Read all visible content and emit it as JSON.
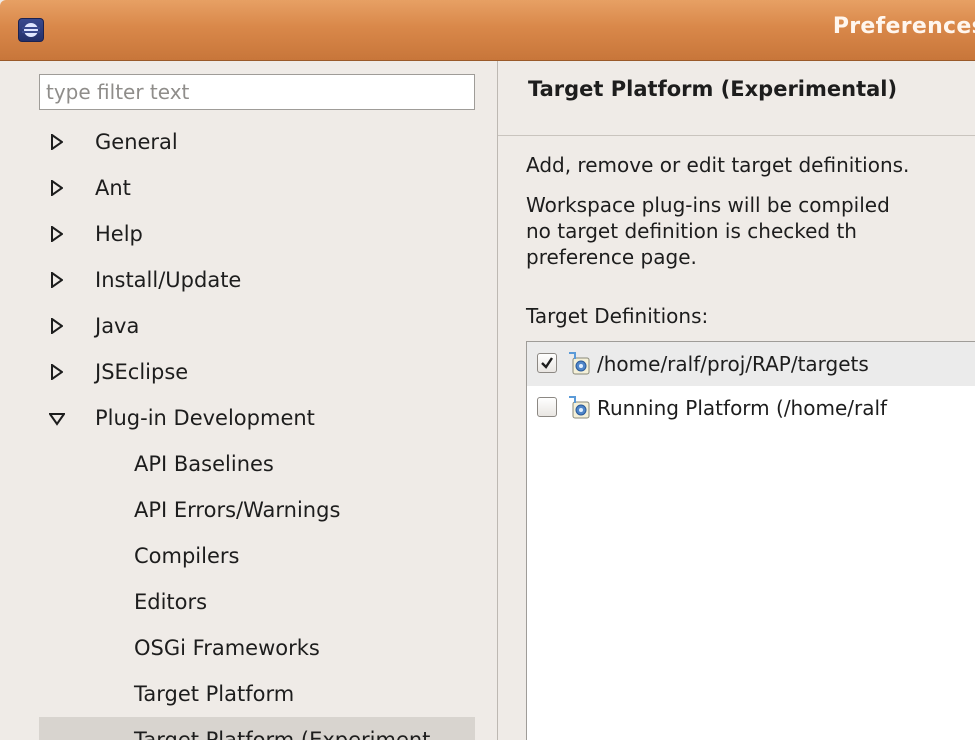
{
  "window": {
    "title": "Preferences"
  },
  "filter": {
    "placeholder": "type filter text",
    "value": ""
  },
  "tree": {
    "items": [
      {
        "label": "General",
        "expanded": false,
        "icon": "triangle-right-icon"
      },
      {
        "label": "Ant",
        "expanded": false,
        "icon": "triangle-right-icon"
      },
      {
        "label": "Help",
        "expanded": false,
        "icon": "triangle-right-icon"
      },
      {
        "label": "Install/Update",
        "expanded": false,
        "icon": "triangle-right-icon"
      },
      {
        "label": "Java",
        "expanded": false,
        "icon": "triangle-right-icon"
      },
      {
        "label": "JSEclipse",
        "expanded": false,
        "icon": "triangle-right-icon"
      },
      {
        "label": "Plug-in Development",
        "expanded": true,
        "icon": "triangle-down-icon"
      }
    ],
    "children": [
      {
        "label": "API Baselines"
      },
      {
        "label": "API Errors/Warnings"
      },
      {
        "label": "Compilers"
      },
      {
        "label": "Editors"
      },
      {
        "label": "OSGi Frameworks"
      },
      {
        "label": "Target Platform"
      },
      {
        "label": "Target Platform (Experiment",
        "selected": true
      }
    ]
  },
  "page": {
    "title": "Target Platform (Experimental)",
    "description_1": "Add, remove or edit target definitions.",
    "description_2_line_1": "Workspace plug-ins will be compiled",
    "description_2_line_2": "no target definition is checked th",
    "description_2_line_3": "preference page.",
    "definitions_label": "Target Definitions:"
  },
  "definitions": [
    {
      "label": "/home/ralf/proj/RAP/targets",
      "checked": true,
      "icon": "target-definition-icon"
    },
    {
      "label": "Running Platform (/home/ralf",
      "checked": false,
      "icon": "target-definition-icon"
    }
  ],
  "colors": {
    "titlebar": "#d9884a",
    "background": "#efebe7",
    "selection": "#d8d4cf"
  }
}
